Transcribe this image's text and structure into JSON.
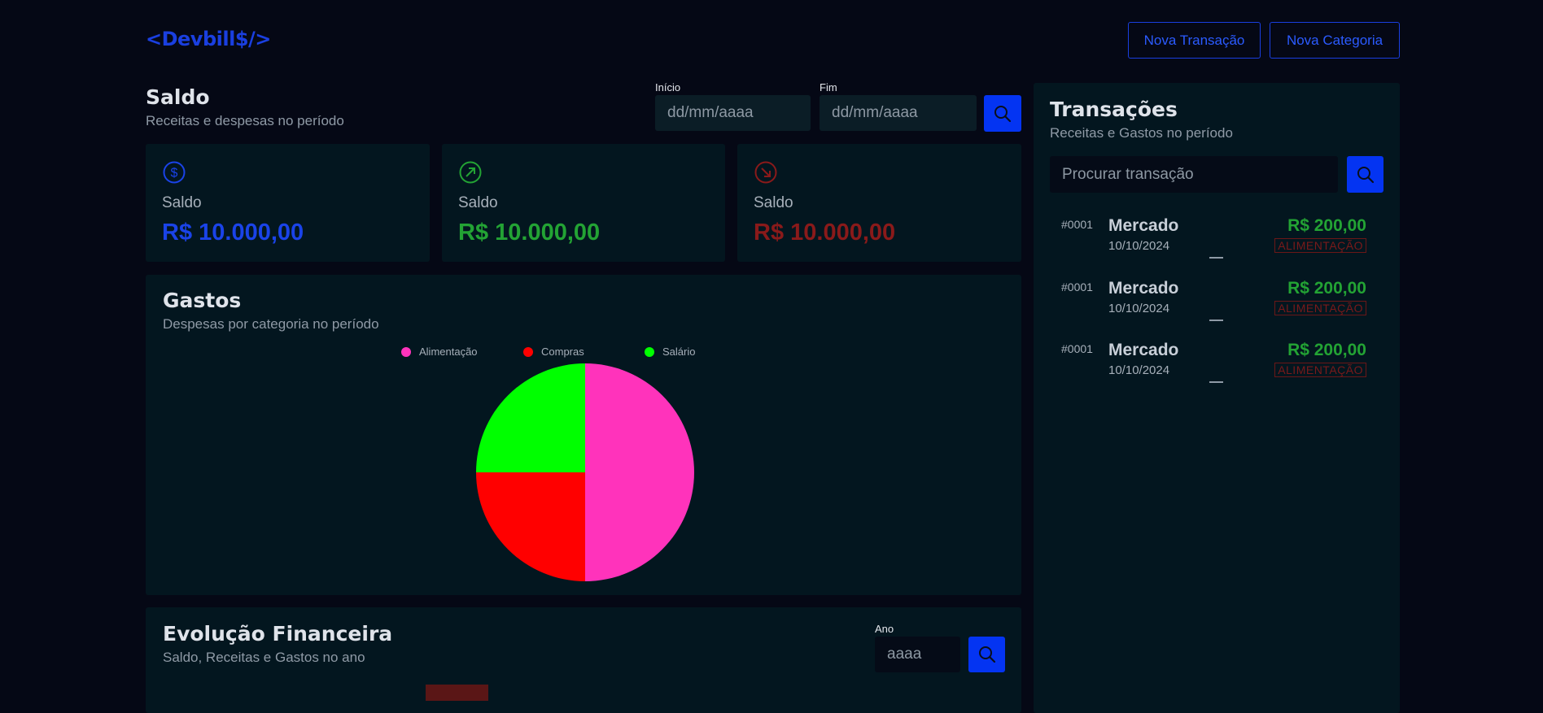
{
  "header": {
    "logo_prefix": "<",
    "logo_name": "Devbill$",
    "logo_suffix": "/>",
    "new_transaction_label": "Nova Transação",
    "new_category_label": "Nova Categoria"
  },
  "balance": {
    "title": "Saldo",
    "subtitle": "Receitas e despesas no período",
    "start_label": "Início",
    "start_placeholder": "dd/mm/aaaa",
    "end_label": "Fim",
    "end_placeholder": "dd/mm/aaaa"
  },
  "cards": [
    {
      "label": "Saldo",
      "value": "R$ 10.000,00",
      "icon": "dollar-circle-icon",
      "color": "#1a43e8"
    },
    {
      "label": "Saldo",
      "value": "R$ 10.000,00",
      "icon": "arrow-up-right-circle-icon",
      "color": "#23a334"
    },
    {
      "label": "Saldo",
      "value": "R$ 10.000,00",
      "icon": "arrow-down-right-circle-icon",
      "color": "#8a1a1a"
    }
  ],
  "expenses": {
    "title": "Gastos",
    "subtitle": "Despesas por categoria no período"
  },
  "chart_data": {
    "type": "pie",
    "categories": [
      "Alimentação",
      "Compras",
      "Salário"
    ],
    "values": [
      50,
      25,
      25
    ],
    "colors": [
      "#ff33bb",
      "#ff0000",
      "#00ff00"
    ],
    "legend_position": "top"
  },
  "evolution": {
    "title": "Evolução Financeira",
    "subtitle": "Saldo, Receitas e Gastos no ano",
    "year_label": "Ano",
    "year_placeholder": "aaaa"
  },
  "transactions": {
    "title": "Transações",
    "subtitle": "Receitas e Gastos no período",
    "search_placeholder": "Procurar transação",
    "items": [
      {
        "id": "#0001",
        "name": "Mercado",
        "date": "10/10/2024",
        "amount": "R$ 200,00",
        "category": "ALIMENTAÇÃO"
      },
      {
        "id": "#0001",
        "name": "Mercado",
        "date": "10/10/2024",
        "amount": "R$ 200,00",
        "category": "ALIMENTAÇÃO"
      },
      {
        "id": "#0001",
        "name": "Mercado",
        "date": "10/10/2024",
        "amount": "R$ 200,00",
        "category": "ALIMENTAÇÃO"
      }
    ]
  }
}
